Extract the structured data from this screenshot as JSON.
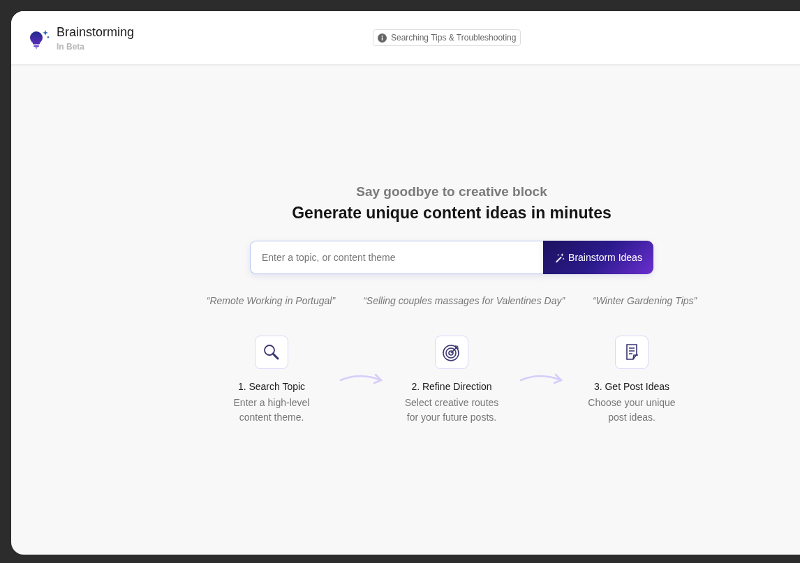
{
  "header": {
    "title": "Brainstorming",
    "subtitle": "In Beta",
    "tips_button": "Searching Tips & Troubleshooting"
  },
  "hero": {
    "tagline": "Say goodbye to creative block",
    "headline": "Generate unique content ideas in minutes"
  },
  "search": {
    "placeholder": "Enter a topic, or content theme",
    "button": "Brainstorm Ideas"
  },
  "examples": [
    "“Remote Working in Portugal”",
    "“Selling couples massages for Valentines Day”",
    "“Winter Gardening Tips”"
  ],
  "steps": [
    {
      "kind": "search",
      "title": "1. Search Topic",
      "description": "Enter a high-level content theme."
    },
    {
      "kind": "target",
      "title": "2. Refine Direction",
      "description": "Select creative routes for your future posts."
    },
    {
      "kind": "notes",
      "title": "3. Get Post Ideas",
      "description": "Choose your unique post ideas."
    }
  ]
}
